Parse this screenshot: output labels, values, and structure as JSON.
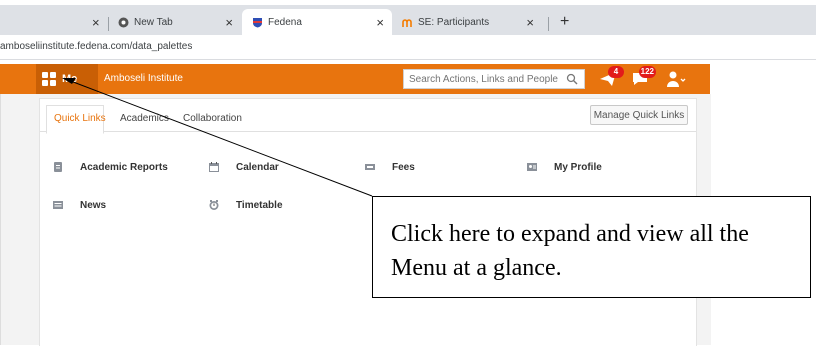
{
  "browser": {
    "tabs": [
      {
        "label": "New Tab",
        "favicon": "chrome-icon"
      },
      {
        "label": "Fedena",
        "favicon": "fedena-shield-icon"
      },
      {
        "label": "SE: Participants",
        "favicon": "moodle-icon"
      }
    ],
    "close_glyph": "×",
    "new_tab_glyph": "+",
    "url": "amboseliinstitute.fedena.com/data_palettes"
  },
  "header": {
    "menu_label": "Me",
    "institute_name": "Amboseli Institute",
    "search_placeholder": "Search Actions, Links and People",
    "messages_badge": "4",
    "notifications_badge": "122",
    "accent_color": "#e8740e"
  },
  "panel": {
    "tabs": [
      "Quick Links",
      "Academics",
      "Collaboration"
    ],
    "manage_button": "Manage Quick Links",
    "quick_links": [
      {
        "label": "Academic Reports",
        "icon": "report-icon"
      },
      {
        "label": "Calendar",
        "icon": "calendar-icon"
      },
      {
        "label": "Fees",
        "icon": "fees-icon"
      },
      {
        "label": "My Profile",
        "icon": "profile-card-icon"
      },
      {
        "label": "News",
        "icon": "news-icon"
      },
      {
        "label": "Timetable",
        "icon": "timetable-icon"
      }
    ]
  },
  "callout": {
    "text": "Click here to expand and view all the Menu at a glance."
  }
}
